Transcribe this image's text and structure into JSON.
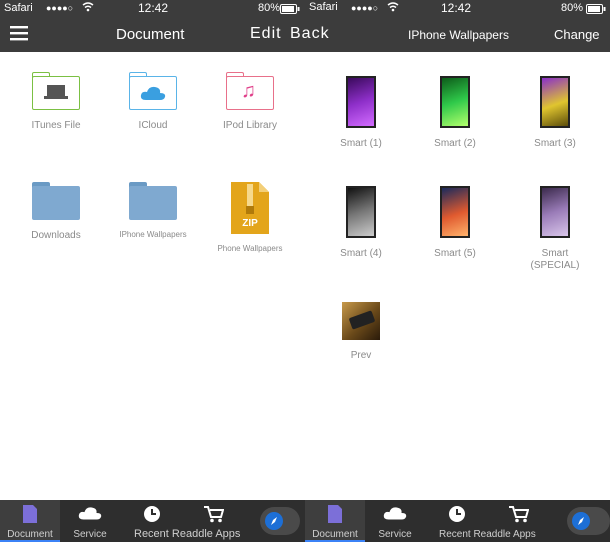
{
  "left": {
    "status": {
      "carrier": "Safari",
      "signal": "●●●●○",
      "time": "12:42",
      "battery": "80%"
    },
    "nav": {
      "title": "Document",
      "edit": "Edit",
      "back": "Back"
    },
    "items": [
      {
        "label": "ITunes File",
        "icon": "itunes-folder-icon"
      },
      {
        "label": "ICloud",
        "icon": "icloud-folder-icon"
      },
      {
        "label": "IPod Library",
        "icon": "music-folder-icon"
      },
      {
        "label": "Downloads",
        "icon": "folder-icon"
      },
      {
        "label": "IPhone Wallpapers",
        "icon": "folder-icon"
      },
      {
        "label": "Phone Wallpapers",
        "icon": "zip-icon",
        "zip_text": "ZIP"
      }
    ],
    "tabs": [
      {
        "label": "Document",
        "icon": "document-icon"
      },
      {
        "label": "Service",
        "icon": "cloud-icon"
      },
      {
        "label": "Recent Readdle Apps",
        "icon": "clock-icon"
      },
      {
        "label": "",
        "icon": "cart-icon"
      },
      {
        "label": "",
        "icon": "compass-icon"
      }
    ]
  },
  "right": {
    "status": {
      "carrier": "Safari",
      "signal": "●●●●○",
      "time": "12:42",
      "battery": "80%"
    },
    "nav": {
      "title": "IPhone Wallpapers",
      "action": "Change"
    },
    "items": [
      {
        "label": "Smart (1)",
        "colors": [
          "#3a0a5c",
          "#8e2fc9",
          "#d26cff"
        ]
      },
      {
        "label": "Smart (2)",
        "colors": [
          "#0d5c1a",
          "#2fc94a",
          "#b3ff6c"
        ]
      },
      {
        "label": "Smart (3)",
        "colors": [
          "#5c4d0a",
          "#e0c52f",
          "#8a2fc9"
        ]
      },
      {
        "label": "Smart (4)",
        "colors": [
          "#111111",
          "#777777",
          "#cccccc"
        ]
      },
      {
        "label": "Smart (5)",
        "colors": [
          "#1a2a5c",
          "#e05a2f",
          "#ffb36c"
        ]
      },
      {
        "label": "Smart (SPECIAL)",
        "colors": [
          "#3b2a4c",
          "#9a7cb8",
          "#d9c6ea"
        ]
      },
      {
        "label": "Prev",
        "colors": [
          "#6b4a1a",
          "#c89a4a",
          "#2a1a0a"
        ]
      }
    ],
    "tabs": [
      {
        "label": "Document",
        "icon": "document-icon"
      },
      {
        "label": "Service",
        "icon": "cloud-icon"
      },
      {
        "label": "Recent Readdle Apps",
        "icon": "clock-icon"
      },
      {
        "label": "",
        "icon": "cart-icon"
      },
      {
        "label": "",
        "icon": "compass-icon"
      }
    ]
  }
}
